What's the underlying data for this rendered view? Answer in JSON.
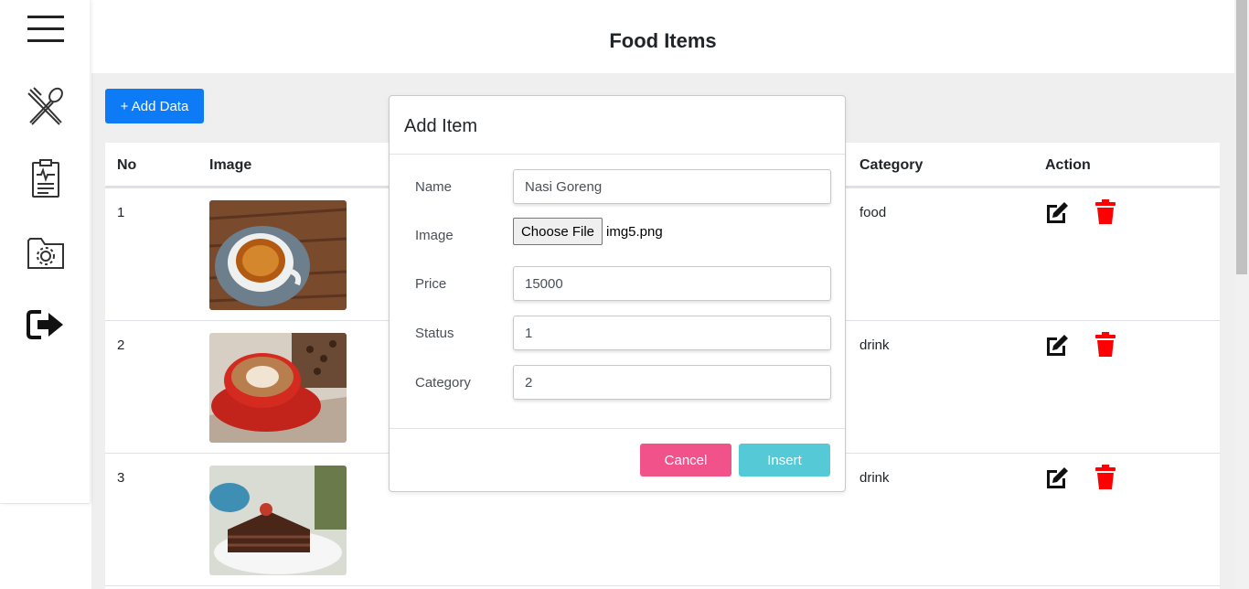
{
  "header": {
    "title": "Food Items"
  },
  "sidebar": {
    "icons": [
      "menu-icon",
      "utensils-icon",
      "clipboard-report-icon",
      "folder-settings-icon",
      "logout-icon"
    ]
  },
  "toolbar": {
    "add_label": "+ Add Data"
  },
  "table": {
    "columns": {
      "no": "No",
      "image": "Image",
      "category": "Category",
      "action": "Action"
    },
    "rows": [
      {
        "no": "1",
        "image": "coffee-cup-photo",
        "category": "food"
      },
      {
        "no": "2",
        "image": "latte-art-photo",
        "category": "drink"
      },
      {
        "no": "3",
        "image": "chocolate-cake-photo",
        "category": "drink"
      }
    ]
  },
  "modal": {
    "title": "Add Item",
    "labels": {
      "name": "Name",
      "image": "Image",
      "price": "Price",
      "status": "Status",
      "category": "Category"
    },
    "values": {
      "name": "Nasi Goreng",
      "file_button": "Choose File",
      "file_name": "img5.png",
      "price": "15000",
      "status": "1",
      "category": "2"
    },
    "cancel_label": "Cancel",
    "insert_label": "Insert"
  },
  "colors": {
    "primary": "#0d7bf5",
    "danger": "#ff0000",
    "cancel": "#f2528a",
    "insert": "#55c9d6"
  }
}
